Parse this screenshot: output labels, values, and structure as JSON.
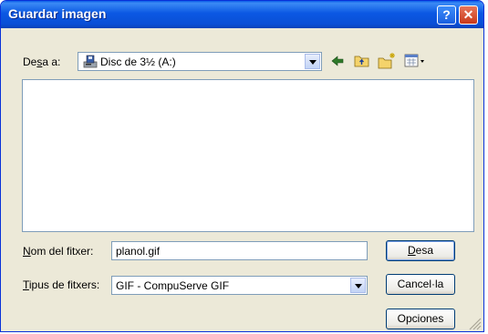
{
  "window": {
    "title": "Guardar imagen"
  },
  "toolbar": {
    "save_in_label_pre": "De",
    "save_in_label_acc": "s",
    "save_in_label_post": "a a:",
    "location": "Disc de 3½ (A:)",
    "icons": [
      "back-arrow-icon",
      "up-folder-icon",
      "new-folder-icon",
      "view-menu-icon"
    ]
  },
  "form": {
    "filename_label_acc": "N",
    "filename_label_post": "om del fitxer:",
    "filename_value": "planol.gif",
    "filetype_label_acc": "T",
    "filetype_label_post": "ipus de fitxers:",
    "filetype_value": "GIF - CompuServe GIF"
  },
  "buttons": {
    "save_acc": "D",
    "save_post": "esa",
    "cancel": "Cancel·la",
    "options": "Opciones"
  },
  "colors": {
    "title_bar": "#0a5ce8",
    "face": "#ece9d8",
    "close": "#c9391a"
  }
}
